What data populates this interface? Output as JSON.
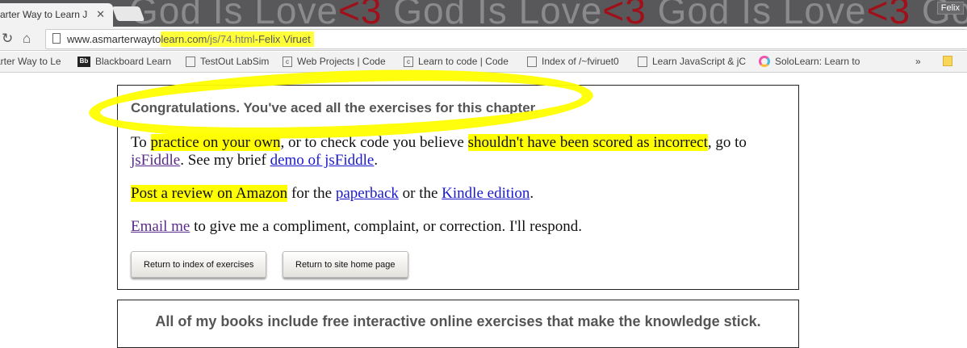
{
  "browser": {
    "tab_title": "arter Way to Learn J",
    "watermark": {
      "text": "God Is Love",
      "heart": "<3"
    },
    "user": "Felix",
    "url": {
      "host_plain": "www.asmarterwayto",
      "host_highlight": "learn.com",
      "path": "/js/74.html",
      "annotation": "-Felix Viruet"
    },
    "bookmarks": [
      {
        "label": "arter Way to Le",
        "icon": "page-icon"
      },
      {
        "label": "Blackboard Learn",
        "icon": "bb"
      },
      {
        "label": "TestOut LabSim",
        "icon": "page-icon"
      },
      {
        "label": "Web Projects | Code",
        "icon": "c"
      },
      {
        "label": "Learn to code | Code",
        "icon": "c"
      },
      {
        "label": "Index of /~fviruet0",
        "icon": "page-icon"
      },
      {
        "label": "Learn JavaScript & jC",
        "icon": "page-icon"
      },
      {
        "label": "SoloLearn: Learn to",
        "icon": "sololearn"
      }
    ],
    "more": "»"
  },
  "main": {
    "heading": "Congratulations. You've aced all the exercises for this chapter.",
    "p1": {
      "t1": "To ",
      "h1": "practice on your own",
      "t2": ", or to check code you believe ",
      "h2": "shouldn't have been scored as incorrect",
      "t3": ", go to ",
      "link1": "jsFiddle",
      "t4": ". See my brief ",
      "link2": "demo of jsFiddle",
      "t5": "."
    },
    "p2": {
      "h1": "Post a review on Amazon",
      "t1": " for the ",
      "link1": "paperback",
      "t2": " or the ",
      "link2": "Kindle edition",
      "t3": "."
    },
    "p3": {
      "link": "Email me",
      "t1": " to give me a compliment, complaint, or correction. I'll respond."
    },
    "buttons": {
      "index": "Return to index of exercises",
      "home": "Return to site home page"
    },
    "footer_heading": "All of my books include free interactive online exercises that make the knowledge stick."
  },
  "colors": {
    "highlight": "#ffff00",
    "link": "#1a1acc",
    "visited": "#5a2a8a"
  }
}
